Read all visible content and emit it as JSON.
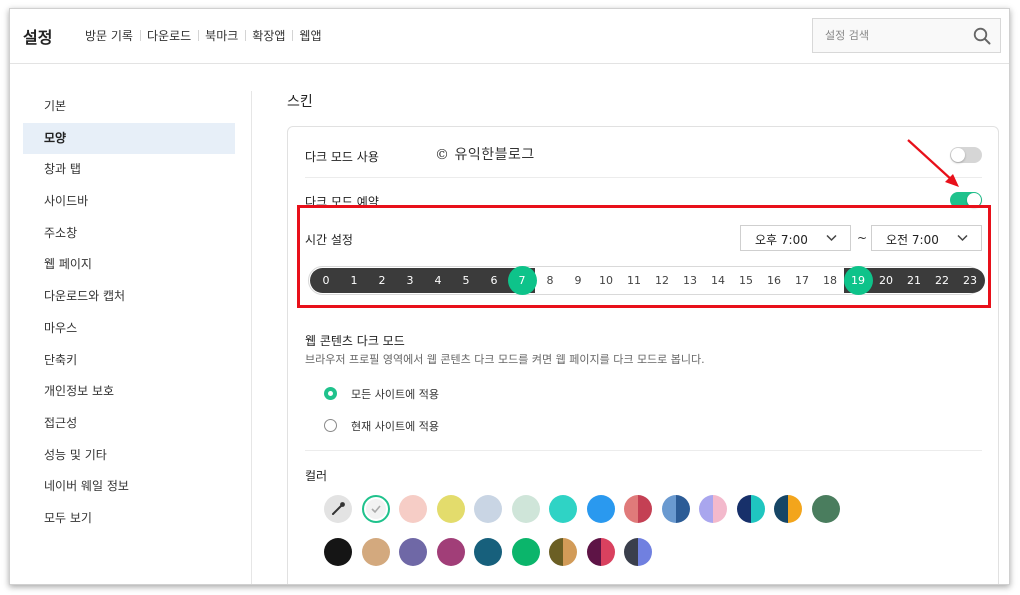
{
  "header": {
    "title": "설정",
    "tabs": [
      "방문 기록",
      "다운로드",
      "북마크",
      "확장앱",
      "웹앱"
    ],
    "search_placeholder": "설정 검색"
  },
  "sidebar": {
    "items": [
      {
        "label": "기본",
        "active": false
      },
      {
        "label": "모양",
        "active": true
      },
      {
        "label": "창과 탭",
        "active": false
      },
      {
        "label": "사이드바",
        "active": false
      },
      {
        "label": "주소창",
        "active": false
      },
      {
        "label": "웹 페이지",
        "active": false
      },
      {
        "label": "다운로드와 캡처",
        "active": false
      },
      {
        "label": "마우스",
        "active": false
      },
      {
        "label": "단축키",
        "active": false
      },
      {
        "label": "개인정보 보호",
        "active": false
      },
      {
        "label": "접근성",
        "active": false
      },
      {
        "label": "성능 및 기타",
        "active": false
      },
      {
        "label": "네이버 웨일 정보",
        "active": false
      },
      {
        "label": "모두 보기",
        "active": false
      }
    ]
  },
  "skin": {
    "section_title": "스킨",
    "dark_mode_label": "다크 모드 사용",
    "dark_mode_on": false,
    "watermark": "© 유익한블로그",
    "dark_mode_schedule_label": "다크 모드 예약",
    "dark_mode_schedule_on": true,
    "time_setting_label": "시간 설정",
    "start_time": "오후 7:00",
    "tilde": "~",
    "end_time": "오전 7:00",
    "hours": [
      "0",
      "1",
      "2",
      "3",
      "4",
      "5",
      "6",
      "7",
      "8",
      "9",
      "10",
      "11",
      "12",
      "13",
      "14",
      "15",
      "16",
      "17",
      "18",
      "19",
      "20",
      "21",
      "22",
      "23"
    ],
    "selected_start_hour": 19,
    "selected_end_hour": 7,
    "web_content_dark_title": "웹 콘텐츠 다크 모드",
    "web_content_dark_desc": "브라우저 프로필 영역에서 웹 콘텐츠 다크 모드를 켜면 웹 페이지를 다크 모드로 봅니다.",
    "radio_options": [
      {
        "label": "모든 사이트에 적용",
        "selected": true
      },
      {
        "label": "현재 사이트에 적용",
        "selected": false
      }
    ],
    "color_label": "컬러",
    "accent_color": "#1fc28c",
    "highlight_color": "#e8101a",
    "colors_row1": [
      {
        "name": "eyedropper",
        "colors": [
          "#e3e3e3"
        ]
      },
      {
        "name": "selected-white",
        "colors": [
          "#f2f2f2"
        ]
      },
      {
        "name": "pink",
        "colors": [
          "#f6cdc6"
        ]
      },
      {
        "name": "yellow",
        "colors": [
          "#e3dc6c"
        ]
      },
      {
        "name": "light-blue-gray",
        "colors": [
          "#c9d5e4"
        ]
      },
      {
        "name": "mint",
        "colors": [
          "#cfe5d9"
        ]
      },
      {
        "name": "teal",
        "colors": [
          "#2fd3c5"
        ]
      },
      {
        "name": "blue",
        "colors": [
          "#2a99ef"
        ]
      },
      {
        "name": "red-split",
        "colors": [
          "#e07a7a",
          "#c44054"
        ]
      },
      {
        "name": "blue-split",
        "colors": [
          "#6a9ad0",
          "#2c5c96"
        ]
      },
      {
        "name": "lavender-pink-split",
        "colors": [
          "#a9a6ee",
          "#f3b9cc"
        ]
      },
      {
        "name": "navy-teal-split",
        "colors": [
          "#17306a",
          "#1fc6c0"
        ]
      },
      {
        "name": "navy-orange-split",
        "colors": [
          "#164666",
          "#f3a51c"
        ]
      },
      {
        "name": "green",
        "colors": [
          "#4a7d5e"
        ]
      }
    ],
    "colors_row2": [
      {
        "name": "black",
        "colors": [
          "#151515"
        ]
      },
      {
        "name": "tan",
        "colors": [
          "#d3a97e"
        ]
      },
      {
        "name": "purple",
        "colors": [
          "#6f68a6"
        ]
      },
      {
        "name": "magenta",
        "colors": [
          "#a13e78"
        ]
      },
      {
        "name": "dark-teal",
        "colors": [
          "#17607c"
        ]
      },
      {
        "name": "emerald",
        "colors": [
          "#0bb56b"
        ]
      },
      {
        "name": "olive-tan-split",
        "colors": [
          "#6b5f24",
          "#d29b58"
        ]
      },
      {
        "name": "plum-rose-split",
        "colors": [
          "#5e1446",
          "#d9415f"
        ]
      },
      {
        "name": "slate-periwinkle-split",
        "colors": [
          "#3a3f4c",
          "#7080e0"
        ]
      }
    ]
  }
}
